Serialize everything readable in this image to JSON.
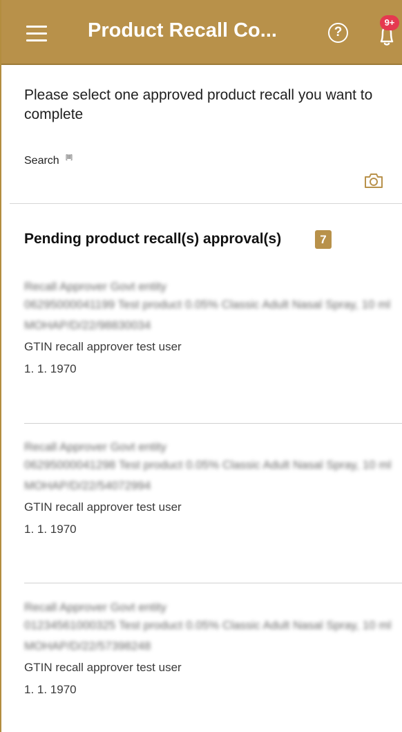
{
  "app_bar": {
    "title": "Product Recall Co...",
    "help_icon": "help-circle-icon",
    "notifications_icon": "bell-icon",
    "notifications_badge": "9+",
    "color": "#B8914A"
  },
  "instruction": "Please select one approved product recall you want to complete",
  "search": {
    "label": "Search",
    "barcode_hint": "[IIII]",
    "placeholder": "",
    "camera_icon": "camera-icon"
  },
  "pending": {
    "title": "Pending product recall(s) approval(s)",
    "count": "7",
    "items": [
      {
        "entity": "Recall Approver Govt entity",
        "product": "06295000041199 Test product 0.05% Classic Adult Nasal Spray, 10 ml",
        "reference": "MOHAP/D/22/98830034",
        "user": "GTIN recall approver test user",
        "date": "1. 1. 1970"
      },
      {
        "entity": "Recall Approver Govt entity",
        "product": "06295000041298 Test product 0.05% Classic Adult Nasal Spray, 10 ml",
        "reference": "MOHAP/D/22/54072994",
        "user": "GTIN recall approver test user",
        "date": "1. 1. 1970"
      },
      {
        "entity": "Recall Approver Govt entity",
        "product": "01234561000325 Test product 0.05% Classic Adult Nasal Spray, 10 ml",
        "reference": "MOHAP/D/22/57398248",
        "user": "GTIN recall approver test user",
        "date": "1. 1. 1970"
      }
    ]
  }
}
